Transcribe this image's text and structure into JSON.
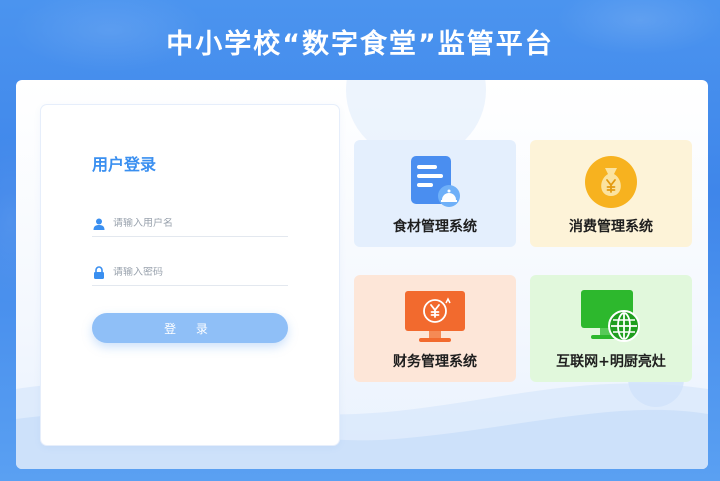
{
  "header": {
    "title": "中小学校“数字食堂”监管平台"
  },
  "login": {
    "title": "用户登录",
    "username_placeholder": "请输入用户名",
    "password_placeholder": "请输入密码",
    "submit_label": "登 录"
  },
  "systems": [
    {
      "label": "食材管理系统",
      "icon": "document-icon"
    },
    {
      "label": "消费管理系统",
      "icon": "money-bag-icon"
    },
    {
      "label": "财务管理系统",
      "icon": "monitor-yuan-icon"
    },
    {
      "label": "互联网+明厨亮灶",
      "icon": "monitor-globe-icon"
    }
  ],
  "colors": {
    "accent": "#3a8ff0",
    "button": "#8fbff7",
    "tile_food": "#e4effd",
    "tile_consume": "#fdf3d8",
    "tile_finance": "#fde6d8",
    "tile_internet": "#e1f8dc"
  }
}
